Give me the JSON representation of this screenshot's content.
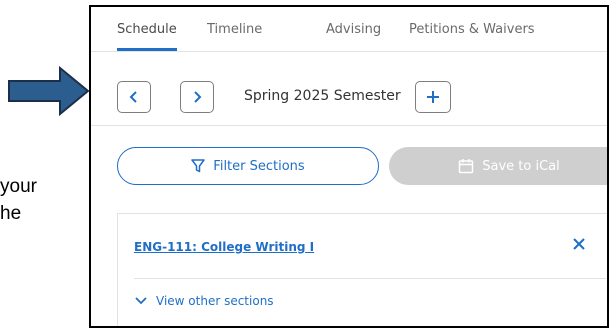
{
  "side_text": {
    "line1": "your",
    "line2": "he"
  },
  "tabs": [
    {
      "label": "Schedule",
      "active": true
    },
    {
      "label": "Timeline",
      "active": false
    },
    {
      "label": "Advising",
      "active": false
    },
    {
      "label": "Petitions & Waivers",
      "active": false
    }
  ],
  "semester": {
    "label": "Spring 2025 Semester",
    "prev_icon": "chevron-left-icon",
    "next_icon": "chevron-right-icon",
    "add_icon": "plus-icon"
  },
  "actions": {
    "filter_label": "Filter Sections",
    "filter_icon": "filter-icon",
    "ical_label": "Save to iCal",
    "ical_icon": "calendar-icon"
  },
  "course": {
    "title": "ENG-111: College Writing I",
    "close_icon": "close-icon",
    "view_other_label": "View other sections",
    "view_other_icon": "chevron-down-icon"
  },
  "colors": {
    "accent": "#1f6fc6",
    "arrow": "#2c5d8f",
    "disabled_button": "#cfcfcf"
  }
}
